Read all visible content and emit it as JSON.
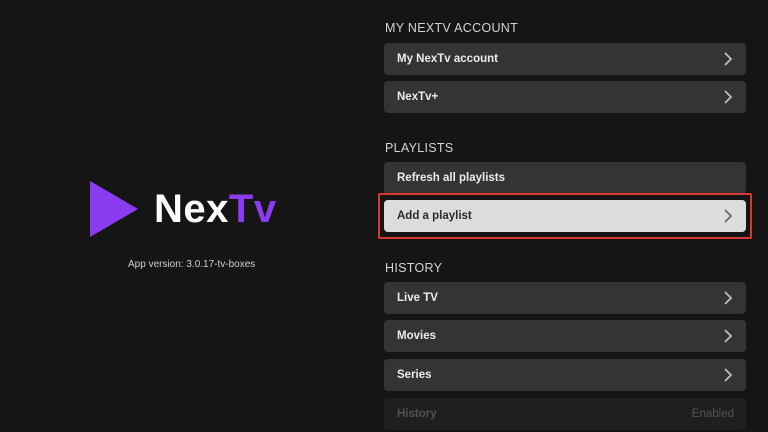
{
  "brand": {
    "logo_part1": "Nex",
    "logo_part2": "Tv",
    "version": "App version: 3.0.17-tv-boxes",
    "accent_color": "#8b3cf0"
  },
  "sections": {
    "account": {
      "title": "MY NEXTV ACCOUNT",
      "items": [
        {
          "label": "My NexTv account",
          "icon": "chevron-right-icon"
        },
        {
          "label": "NexTv+",
          "icon": "chevron-right-icon"
        }
      ]
    },
    "playlists": {
      "title": "PLAYLISTS",
      "items": [
        {
          "label": "Refresh all playlists"
        },
        {
          "label": "Add a playlist",
          "icon": "chevron-right-icon",
          "focused": true
        }
      ]
    },
    "history": {
      "title": "HISTORY",
      "items": [
        {
          "label": "Live TV",
          "icon": "chevron-right-icon"
        },
        {
          "label": "Movies",
          "icon": "chevron-right-icon"
        },
        {
          "label": "Series",
          "icon": "chevron-right-icon"
        },
        {
          "label": "History",
          "value": "Enabled"
        }
      ]
    }
  },
  "focus_color": "#d63a2e"
}
